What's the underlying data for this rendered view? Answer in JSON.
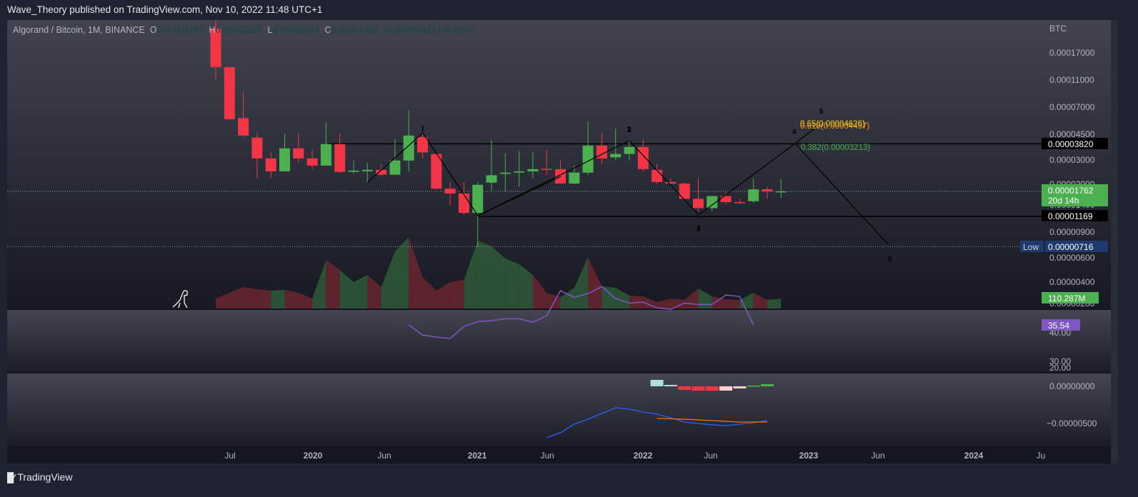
{
  "header": {
    "published": "Wave_Theory published on TradingView.com, Nov 10, 2022 11:48 UTC+1"
  },
  "legend": {
    "symbol": "Algorand / Bitcoin, 1M, BINANCE",
    "o_label": "O",
    "o": "0.00001751",
    "h_label": "H",
    "h": "0.00002151",
    "l_label": "L",
    "l": "0.00001574",
    "c_label": "C",
    "c": "0.00001762",
    "change": "+0.00000012 (+0.69%)"
  },
  "price_axis": {
    "unit": "BTC",
    "ticks": [
      "0.00017000",
      "0.00011000",
      "0.00007000",
      "0.00004500",
      "0.00003000",
      "0.00002000",
      "0.00001400",
      "0.00000900",
      "0.00000600",
      "0.00000400",
      "0.00000280"
    ],
    "tag_resistance": "0.00003820",
    "tag_current": "0.00001762",
    "tag_countdown": "20d 14h",
    "tag_support": "0.00001169",
    "tag_low_label": "Low",
    "tag_low": "0.00000716",
    "tag_volume": "110.287M"
  },
  "rsi_axis": {
    "ticks": [
      "40.00",
      "30.00",
      "20.00"
    ],
    "value": "35.54"
  },
  "macd_axis": {
    "ticks": [
      "0.00000000",
      "−0.00000500"
    ]
  },
  "time_axis": [
    "Jul",
    "2020",
    "Jun",
    "2021",
    "Jun",
    "2022",
    "Jun",
    "2023",
    "Jun",
    "2024",
    "Ju"
  ],
  "annotations": {
    "fib_065": "0.65(0.00004626)",
    "fib_0618": "0.618(0.00004457)",
    "fib_0382": "0.382(0.00003213)",
    "waves": [
      "1",
      "2",
      "2",
      "3",
      "4",
      "4",
      "5",
      "5"
    ]
  },
  "footer": {
    "brand": "TradingView"
  },
  "colors": {
    "up": "#4caf50",
    "down": "#f23645",
    "rsi": "#7e57c2",
    "macd": "#2962ff",
    "signal": "#ff6d00",
    "fib_gold": "#f5c518",
    "fib_orange": "#ff9800",
    "fib_green": "#4caf50"
  },
  "chart_data": {
    "type": "candlestick",
    "title": "Algorand / Bitcoin, 1M, BINANCE",
    "ylabel": "BTC",
    "yscale": "log",
    "months": [
      "2019-06",
      "2019-07",
      "2019-08",
      "2019-09",
      "2019-10",
      "2019-11",
      "2019-12",
      "2020-01",
      "2020-02",
      "2020-03",
      "2020-04",
      "2020-05",
      "2020-06",
      "2020-07",
      "2020-08",
      "2020-09",
      "2020-10",
      "2020-11",
      "2020-12",
      "2021-01",
      "2021-02",
      "2021-03",
      "2021-04",
      "2021-05",
      "2021-06",
      "2021-07",
      "2021-08",
      "2021-09",
      "2021-10",
      "2021-11",
      "2021-12",
      "2022-01",
      "2022-02",
      "2022-03",
      "2022-04",
      "2022-05",
      "2022-06",
      "2022-07",
      "2022-08",
      "2022-09",
      "2022-10",
      "2022-11"
    ],
    "ohlc_sats": [
      [
        25000,
        30000,
        11000,
        13300
      ],
      [
        13300,
        13300,
        5600,
        5700
      ],
      [
        5800,
        8900,
        4270,
        4370
      ],
      [
        4230,
        4570,
        2180,
        3010
      ],
      [
        3010,
        3350,
        2180,
        2440
      ],
      [
        2440,
        4500,
        2440,
        3550
      ],
      [
        3550,
        4570,
        2810,
        3010
      ],
      [
        3010,
        3470,
        2530,
        2680
      ],
      [
        2680,
        5380,
        2680,
        3800
      ],
      [
        3800,
        4500,
        2370,
        2420
      ],
      [
        2420,
        2910,
        2370,
        2470
      ],
      [
        2440,
        2810,
        2050,
        2500
      ],
      [
        2500,
        2740,
        2260,
        2310
      ],
      [
        2310,
        4130,
        2310,
        2910
      ],
      [
        2910,
        6550,
        2440,
        4370
      ],
      [
        4270,
        4570,
        3010,
        3320
      ],
      [
        3240,
        3240,
        1820,
        1840
      ],
      [
        1840,
        2050,
        1400,
        1700
      ],
      [
        1700,
        2050,
        1200,
        1240
      ],
      [
        1240,
        2050,
        716,
        1960
      ],
      [
        2030,
        4040,
        1780,
        2290
      ],
      [
        2340,
        3280,
        1760,
        2390
      ],
      [
        2390,
        3390,
        1900,
        2440
      ],
      [
        2440,
        3350,
        2180,
        2530
      ],
      [
        2540,
        3470,
        2310,
        2530
      ],
      [
        2530,
        2910,
        2000,
        2000
      ],
      [
        2000,
        2680,
        1980,
        2390
      ],
      [
        2390,
        5500,
        2310,
        3710
      ],
      [
        3710,
        4570,
        2740,
        3010
      ],
      [
        3060,
        4900,
        2910,
        3240
      ],
      [
        3240,
        4090,
        2910,
        3630
      ],
      [
        3630,
        4090,
        2440,
        2530
      ],
      [
        2500,
        2740,
        1980,
        2050
      ],
      [
        2050,
        2180,
        1980,
        2000
      ],
      [
        2000,
        2050,
        1510,
        1560
      ],
      [
        1560,
        2180,
        1270,
        1340
      ],
      [
        1340,
        1650,
        1270,
        1630
      ],
      [
        1630,
        1740,
        1430,
        1480
      ],
      [
        1480,
        1560,
        1430,
        1460
      ],
      [
        1500,
        2180,
        1460,
        1820
      ],
      [
        1820,
        1900,
        1560,
        1760
      ],
      [
        1751,
        2151,
        1574,
        1762
      ]
    ],
    "volume_m": [
      110,
      175,
      237,
      213,
      198,
      205,
      174,
      110,
      537,
      427,
      292,
      371,
      237,
      632,
      790,
      348,
      198,
      292,
      316,
      750,
      687,
      553,
      490,
      371,
      174,
      126,
      229,
      569,
      245,
      229,
      142,
      134,
      71,
      110,
      95,
      221,
      134,
      103,
      95,
      174,
      95,
      110
    ],
    "levels_sats": {
      "resistance": 3820,
      "support": 1169,
      "low": 716,
      "current": 1762
    },
    "rsi": {
      "start_index": 14,
      "values": [
        35.5,
        32,
        31.3,
        30.8,
        35.0,
        36.7,
        37.0,
        37.7,
        37.7,
        36.5,
        38.7,
        47.5,
        45.2,
        46.5,
        49.0,
        44.7,
        43.2,
        43.5,
        41.5,
        41.0,
        43.2,
        42.7,
        42.7,
        46.0,
        45.5,
        35.54
      ]
    },
    "macd": {
      "start_index": 24,
      "macd": [
        -691,
        -624,
        -509,
        -442,
        -365,
        -288,
        -307,
        -346,
        -374,
        -422,
        -480,
        -499,
        -518,
        -528,
        -509,
        -490,
        -461
      ],
      "signal_start_index": 32,
      "signal": [
        -432,
        -437,
        -442,
        -452,
        -461,
        -470,
        -480,
        -480,
        -480
      ],
      "hist_start_index": 32,
      "hist": [
        87,
        19,
        -48,
        -58,
        -58,
        -58,
        -29,
        10,
        29
      ],
      "unit": "1e-8 BTC"
    }
  }
}
